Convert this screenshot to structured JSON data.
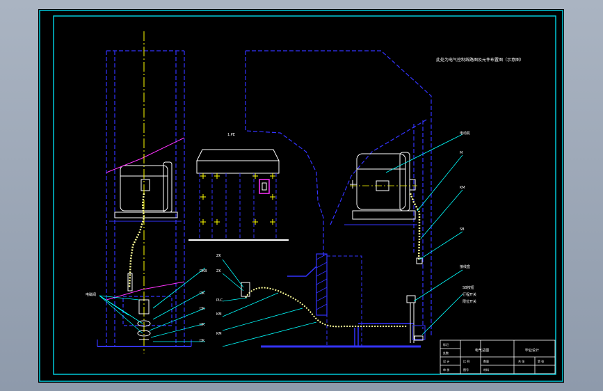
{
  "drawing": {
    "top_note": "此处为电气控制线路图及元件布置图（示意图）",
    "center_label": "1.PE",
    "left_callout_label": "电磁阀",
    "callouts_mid": [
      "DKB",
      "DK",
      "DK",
      "DK",
      "DK"
    ],
    "callouts_cable": [
      "ZK",
      "ZK",
      "PLC",
      "KM",
      "KM"
    ],
    "callouts_right": [
      "电动机",
      "M",
      "KM",
      "SB",
      "接线盒"
    ],
    "callout_right_box": [
      "SB按钮",
      "行程开关",
      "限位开关"
    ]
  },
  "title_block": {
    "name_cell": "电气总图",
    "design_cell": "毕业设计",
    "row_labels": [
      "设 计",
      "审 核",
      "比 例"
    ],
    "sub_labels": [
      "数量",
      "材料",
      "图号"
    ],
    "sheet_cell": "共  张",
    "page_cell": "第  张",
    "tiny_cells": [
      "标记",
      "处数"
    ]
  },
  "colors": {
    "frame": "#00c8d8",
    "structure": "#3333ff",
    "motor": "#ffffff",
    "center_line": "#ffff00",
    "chain": "#ffff99",
    "callout": "#00ffff",
    "magenta": "#ff33ff",
    "cross": "#ffff00"
  }
}
